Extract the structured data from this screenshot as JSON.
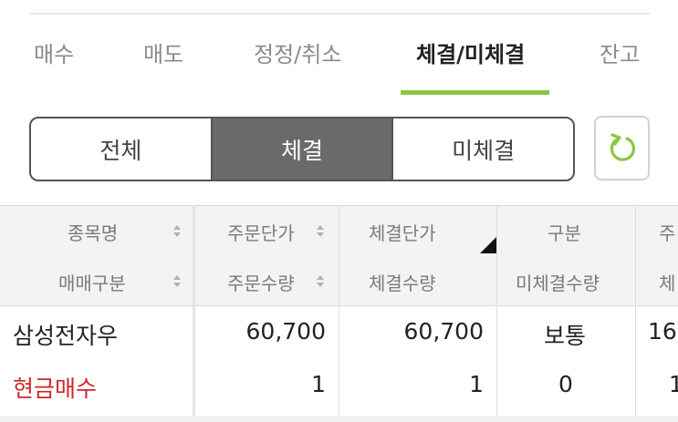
{
  "tabs": [
    {
      "label": "매수"
    },
    {
      "label": "매도"
    },
    {
      "label": "정정/취소"
    },
    {
      "label": "체결/미체결"
    },
    {
      "label": "잔고"
    }
  ],
  "active_tab": "체결/미체결",
  "filter": {
    "options": [
      "전체",
      "체결",
      "미체결"
    ],
    "selected": "체결"
  },
  "refresh_icon": "refresh-icon",
  "table": {
    "headers": {
      "col1_top": "종목명",
      "col1_bottom": "매매구분",
      "col2_top": "주문단가",
      "col2_bottom": "주문수량",
      "col3_top": "체결단가",
      "col3_bottom": "체결수량",
      "col4_top": "구분",
      "col4_bottom": "미체결수량",
      "col5_top": "주",
      "col5_bottom": "체"
    },
    "rows": [
      {
        "name": "삼성전자우",
        "trade_type": "현금매수",
        "order_price": "60,700",
        "order_qty": "1",
        "exec_price": "60,700",
        "exec_qty": "1",
        "category": "보통",
        "unexec_qty": "0",
        "col5_top": "16",
        "col5_bottom": "1"
      }
    ]
  },
  "colors": {
    "accent_green": "#8cc63f",
    "segment_active": "#6a6a6a",
    "sell_buy_red": "#d0262c"
  }
}
